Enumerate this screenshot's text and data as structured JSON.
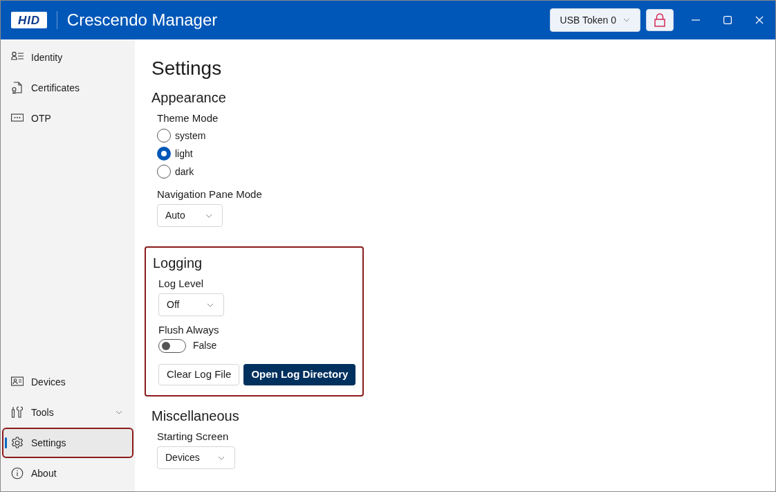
{
  "window": {
    "logo": "HID",
    "title": "Crescendo Manager",
    "device_selector": {
      "value": "USB Token 0"
    },
    "lock_button": {
      "locked": true
    }
  },
  "sidebar": {
    "items": [
      {
        "label": "Identity",
        "selected": false,
        "highlighted": false
      },
      {
        "label": "Certificates",
        "selected": false,
        "highlighted": false
      },
      {
        "label": "OTP",
        "selected": false,
        "highlighted": false
      }
    ],
    "bottom_items": [
      {
        "label": "Devices",
        "selected": false,
        "highlighted": false,
        "expandable": false
      },
      {
        "label": "Tools",
        "selected": false,
        "highlighted": false,
        "expandable": true
      },
      {
        "label": "Settings",
        "selected": true,
        "highlighted": true,
        "expandable": false
      },
      {
        "label": "About",
        "selected": false,
        "highlighted": false,
        "expandable": false
      }
    ]
  },
  "page": {
    "title": "Settings",
    "sections": [
      {
        "title": "Appearance",
        "highlighted": false,
        "fields": [
          {
            "kind": "radio",
            "label": "Theme Mode",
            "options": [
              {
                "label": "system",
                "selected": false
              },
              {
                "label": "light",
                "selected": true
              },
              {
                "label": "dark",
                "selected": false
              }
            ]
          },
          {
            "kind": "dropdown",
            "label": "Navigation Pane Mode",
            "value": "Auto"
          }
        ]
      },
      {
        "title": "Logging",
        "highlighted": true,
        "fields": [
          {
            "kind": "dropdown",
            "label": "Log Level",
            "value": "Off"
          },
          {
            "kind": "toggle",
            "label": "Flush Always",
            "on": false,
            "value": "False"
          },
          {
            "kind": "buttons",
            "buttons": [
              {
                "label": "Clear Log File",
                "primary": false
              },
              {
                "label": "Open Log Directory",
                "primary": true
              }
            ]
          }
        ]
      },
      {
        "title": "Miscellaneous",
        "highlighted": false,
        "fields": [
          {
            "kind": "dropdown",
            "label": "Starting Screen",
            "value": "Devices"
          }
        ]
      }
    ]
  }
}
